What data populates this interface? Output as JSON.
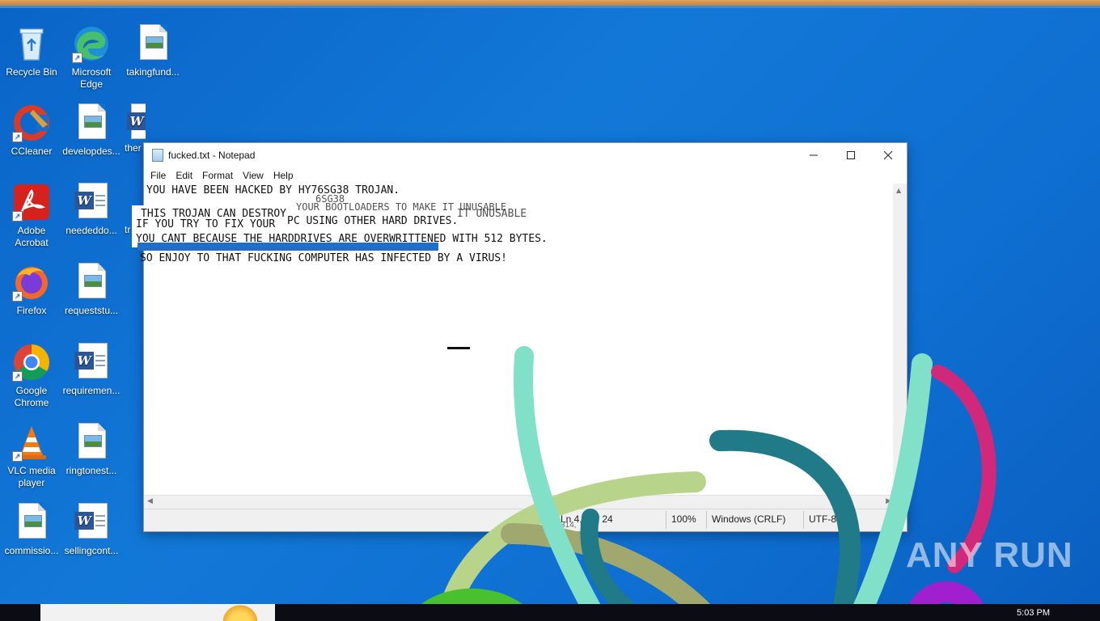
{
  "desktop": {
    "icons": [
      {
        "label": "Recycle Bin",
        "icon": "recycle-bin-icon"
      },
      {
        "label": "Microsoft Edge",
        "icon": "edge-icon"
      },
      {
        "label": "takingfund...",
        "icon": "image-file-icon"
      },
      {
        "label": "CCleaner",
        "icon": "ccleaner-icon"
      },
      {
        "label": "developdes...",
        "icon": "image-file-icon"
      },
      {
        "label": "ther",
        "icon": "word-doc-icon"
      },
      {
        "label": "Adobe Acrobat",
        "icon": "acrobat-icon"
      },
      {
        "label": "neededdo...",
        "icon": "word-doc-icon"
      },
      {
        "label": "tr",
        "icon": "file-icon"
      },
      {
        "label": "Firefox",
        "icon": "firefox-icon"
      },
      {
        "label": "requeststu...",
        "icon": "image-file-icon"
      },
      {
        "label": "Google Chrome",
        "icon": "chrome-icon"
      },
      {
        "label": "requiremen...",
        "icon": "word-doc-icon"
      },
      {
        "label": "VLC media player",
        "icon": "vlc-icon"
      },
      {
        "label": "ringtonest...",
        "icon": "image-file-icon"
      },
      {
        "label": "commissio...",
        "icon": "image-file-icon"
      },
      {
        "label": "sellingcont...",
        "icon": "word-doc-icon"
      }
    ]
  },
  "notepad": {
    "title": "fucked.txt - Notepad",
    "menu": [
      "File",
      "Edit",
      "Format",
      "View",
      "Help"
    ],
    "lines": {
      "l1": "YOU HAVE BEEN HACKED BY HY76SG38 TROJAN.",
      "l1b": "6SG38",
      "l2": "YOUR BOOTLOADERS TO MAKE IT UNUSABLE",
      "l3": "THIS TROJAN CAN DESTROY",
      "l3b": "IT UNUSABLE",
      "l4": "IF YOU TRY TO FIX YOUR",
      "l4b": "PC USING OTHER HARD DRIVES.",
      "l5": "YOU CANT BECAUSE THE HARDDRIVES ARE OVERWRITTENED WITH 512 BYTES.",
      "l6": "SO ENJOY TO THAT FUCKING COMPUTER HAS INFECTED BY A VIRUS!"
    },
    "status": {
      "position": "Ln 4, Col 24",
      "position_ghost": "314,",
      "zoom": "100%",
      "line_ending": "Windows (CRLF)",
      "encoding": "UTF-8"
    }
  },
  "taskbar": {
    "clock": "5:03 PM"
  },
  "watermark": "ANY RUN"
}
